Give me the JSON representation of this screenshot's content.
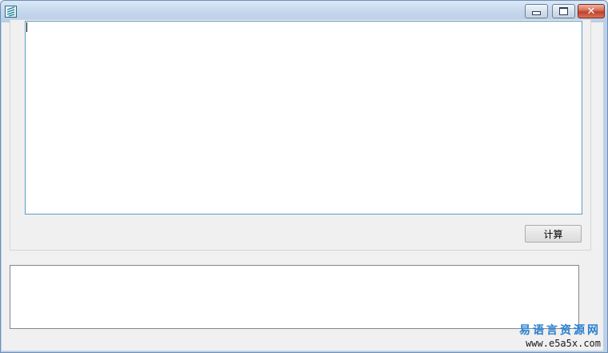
{
  "window": {
    "title": "",
    "controls": {
      "minimize_icon": "minimize-icon",
      "maximize_icon": "maximize-icon",
      "close_label": "✕"
    }
  },
  "main": {
    "input_text": "",
    "calculate_button_label": "计算",
    "output_text": ""
  },
  "watermark": {
    "site_name": "易语言资源网",
    "url": "www.e5a5x.com"
  },
  "colors": {
    "titlebar": "#c3d6ec",
    "client_bg": "#f0f0f0",
    "input_border": "#5a9ec9",
    "watermark_accent": "#2a7fd0",
    "close_button": "#c2402a"
  }
}
